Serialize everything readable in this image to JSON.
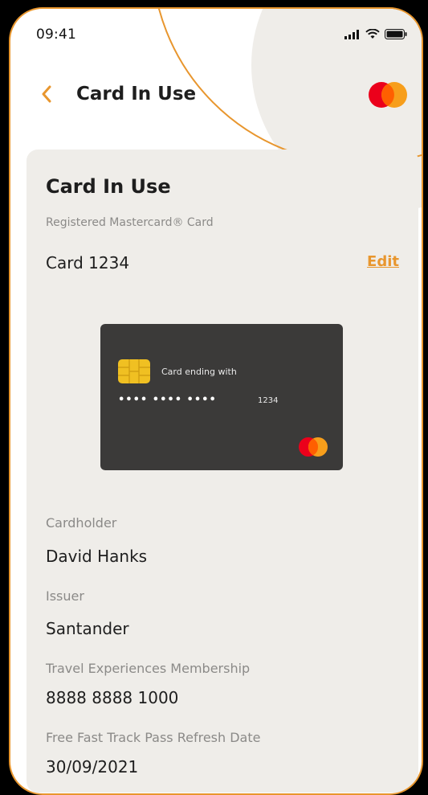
{
  "status_bar": {
    "time": "09:41",
    "icons": [
      "signal-icon",
      "wifi-icon",
      "battery-icon"
    ]
  },
  "header": {
    "title": "Card In Use",
    "back_icon": "chevron-left-icon",
    "logo": "mastercard-logo"
  },
  "card_panel": {
    "title": "Card In Use",
    "subtitle": "Registered Mastercard® Card",
    "card_name": "Card 1234",
    "edit_label": "Edit"
  },
  "card_visual": {
    "ending_label": "Card ending with",
    "masked_number": "•••• •••• ••••",
    "last4": "1234",
    "chip_icon": "card-chip-icon",
    "logo": "mastercard-logo"
  },
  "details": [
    {
      "label": "Cardholder",
      "value": "David Hanks"
    },
    {
      "label": "Issuer",
      "value": "Santander"
    },
    {
      "label": "Travel Experiences Membership",
      "value": "8888 8888 1000"
    },
    {
      "label": "Free Fast Track Pass Refresh Date",
      "value": "30/09/2021"
    }
  ],
  "colors": {
    "accent": "#e8962e",
    "background": "#000000",
    "panel": "#efede9",
    "card": "#3b3a39",
    "mastercard_red": "#eb001b",
    "mastercard_orange": "#f79e1b"
  }
}
